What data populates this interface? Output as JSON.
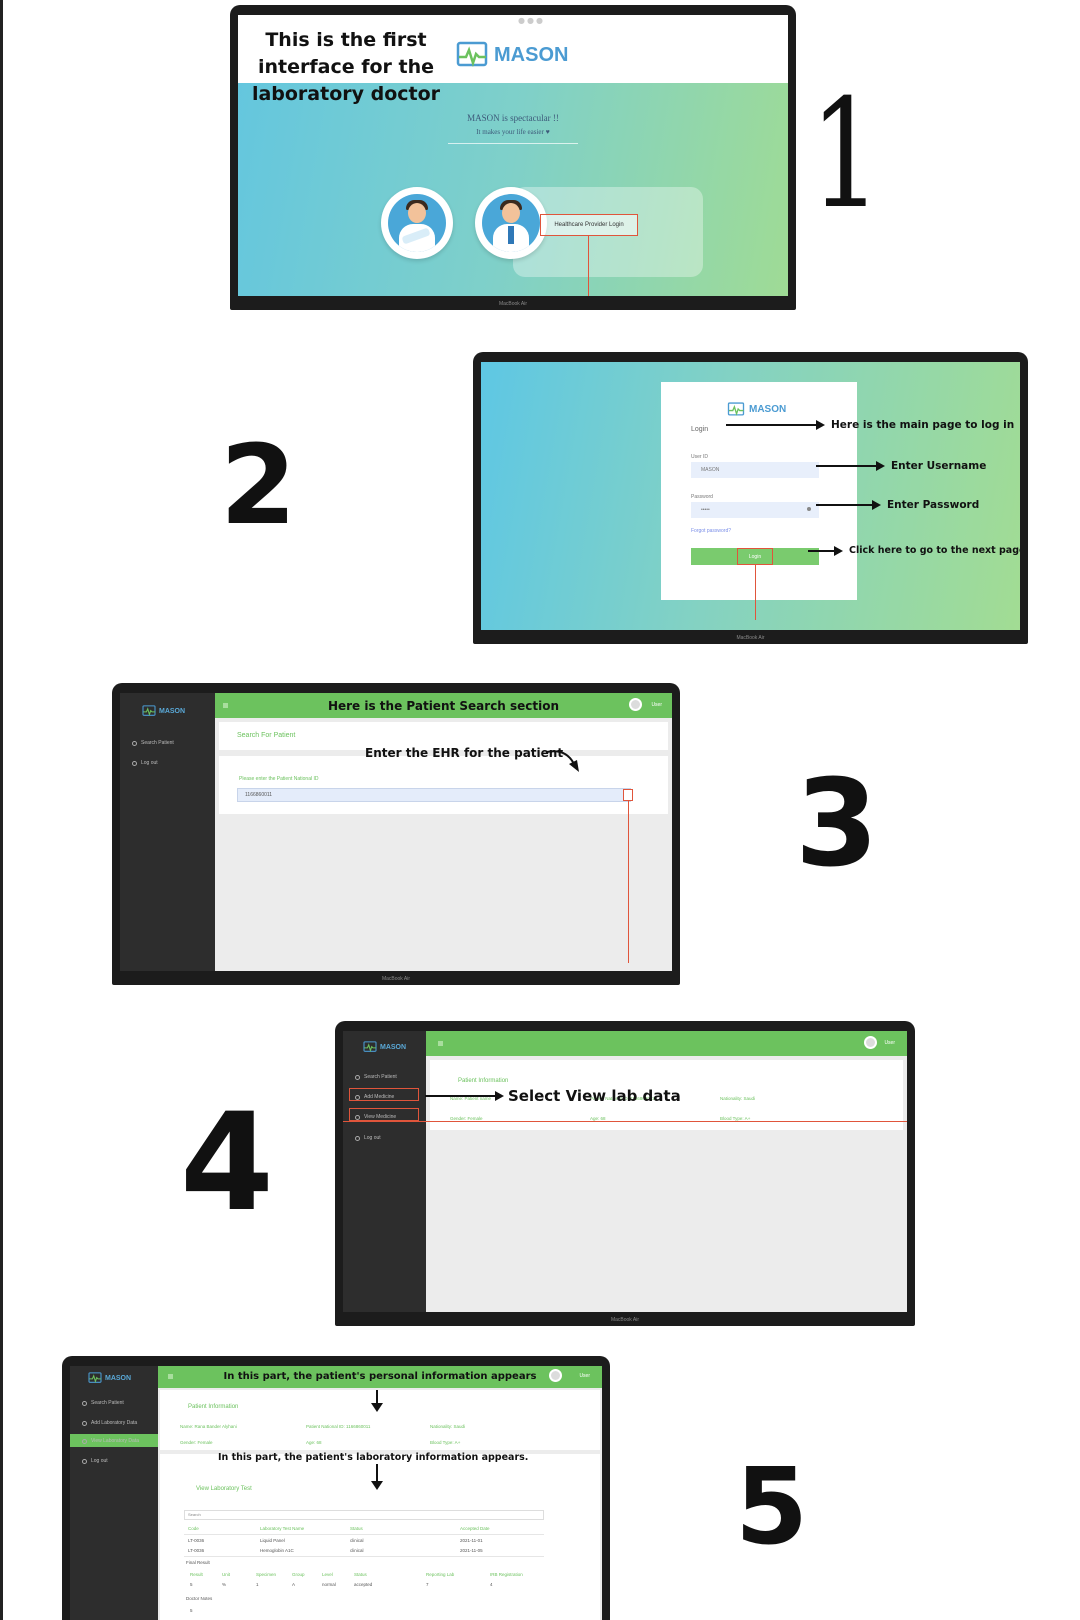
{
  "step_numbers": [
    "1",
    "2",
    "3",
    "4",
    "5"
  ],
  "app": {
    "name": "MASON",
    "brand_color": "#4b9bd2",
    "accent_green": "#6cc25e",
    "highlight_red": "#e0553b"
  },
  "laptop_label": "MacBook Air",
  "screen1": {
    "caption": "This is the first interface for the laboratory doctor",
    "tagline": "MASON is spectacular !!",
    "subtagline": "It makes your life easier ♥",
    "button": "Healthcare Provider Login"
  },
  "screen2": {
    "login_title": "Login",
    "user_label": "User ID",
    "user_value": "MASON",
    "password_label": "Password",
    "password_value": "•••••",
    "forgot": "Forgot password?",
    "button": "Login",
    "annotations": [
      "Here is the main page to log in",
      "Enter Username",
      "Enter Password",
      "Click here to go to the next page"
    ]
  },
  "screen3": {
    "header": "Here is the Patient Search section",
    "sidebar": [
      "Search Patient",
      "Log out"
    ],
    "user": "User",
    "search_title": "Search For Patient",
    "input_label": "Please enter the Patient National ID",
    "input_value": "1166860011",
    "annotation": "Enter the EHR for the patient"
  },
  "screen4": {
    "sidebar": [
      "Search Patient",
      "Add Medicine",
      "View Medicine",
      "Log out"
    ],
    "user": "User",
    "panel_title": "Patient Information",
    "fields": [
      "Name: Patient name",
      "Patient National ID: 1166860011",
      "Nationality: Saudi",
      "Gender: Female",
      "Age: 68",
      "Blood Type: A+"
    ],
    "annotation": "Select View lab data"
  },
  "screen5": {
    "header": "In this part, the patient's personal information appears",
    "annotation2": "In this part, the patient's laboratory information appears.",
    "sidebar": [
      "Search Patient",
      "Add Laboratory Data",
      "View Laboratory Data",
      "Log out"
    ],
    "user": "User",
    "panel_title": "Patient Information",
    "fields": [
      "Name: Rana Bander Alyhani",
      "Patient National ID: 1166860011",
      "Nationality: Saudi",
      "Gender: Female",
      "Age: 68",
      "Blood Type: A+"
    ],
    "lab_title": "View Laboratory Test",
    "search": "Search",
    "table_headers": [
      "Code",
      "Laboratory Test Name",
      "Status",
      "Accepted Date"
    ],
    "rows": [
      [
        "LT-0036",
        "Liquid Panel",
        "clinical",
        "2021-11-01"
      ],
      [
        "LT-0036",
        "Hemoglobin A1C",
        "clinical",
        "2021-11-05"
      ]
    ],
    "sub_label": "Final Result",
    "sub_headers": [
      "Result",
      "Unit",
      "Specimen",
      "Group",
      "Level",
      "Status",
      "Reporting Lab",
      "IRB Registration"
    ],
    "sub_row": [
      "5",
      "%",
      "1",
      "A",
      "normal",
      "accepted",
      "7",
      "4"
    ],
    "note_label": "Doctor Notes",
    "note_value": "5"
  }
}
